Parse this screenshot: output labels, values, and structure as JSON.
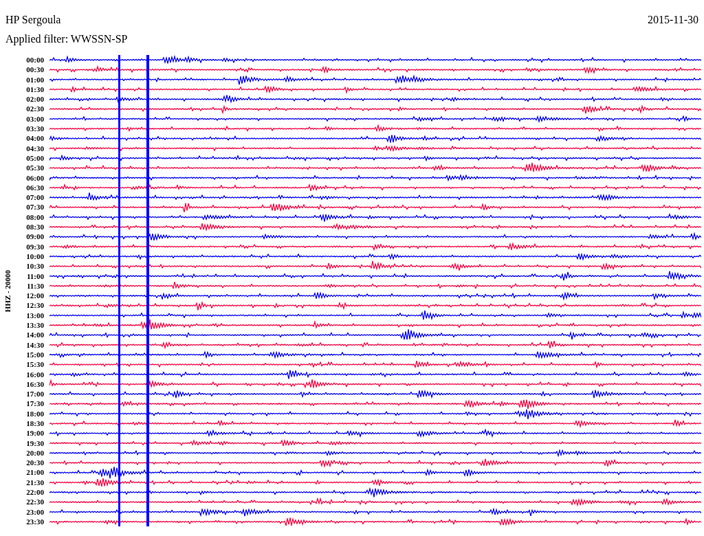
{
  "header": {
    "station": "HP Sergoula",
    "date": "2015-11-30",
    "filter": "Applied filter: WWSSN-SP"
  },
  "axis_label": "HHZ - 20000",
  "traces": [
    {
      "time": "00:00",
      "color": "#0000ff"
    },
    {
      "time": "00:30",
      "color": "#ff0040"
    },
    {
      "time": "01:00",
      "color": "#0000ff"
    },
    {
      "time": "01:30",
      "color": "#ff0040"
    },
    {
      "time": "02:00",
      "color": "#0000ff"
    },
    {
      "time": "02:30",
      "color": "#ff0040"
    },
    {
      "time": "03:00",
      "color": "#0000ff"
    },
    {
      "time": "03:30",
      "color": "#ff0040"
    },
    {
      "time": "04:00",
      "color": "#0000ff"
    },
    {
      "time": "04:30",
      "color": "#ff0040"
    },
    {
      "time": "05:00",
      "color": "#0000ff"
    },
    {
      "time": "05:30",
      "color": "#ff0040"
    },
    {
      "time": "06:00",
      "color": "#0000ff"
    },
    {
      "time": "06:30",
      "color": "#ff0040"
    },
    {
      "time": "07:00",
      "color": "#0000ff"
    },
    {
      "time": "07:30",
      "color": "#ff0040"
    },
    {
      "time": "08:00",
      "color": "#0000ff"
    },
    {
      "time": "08:30",
      "color": "#ff0040"
    },
    {
      "time": "09:00",
      "color": "#0000ff"
    },
    {
      "time": "09:30",
      "color": "#ff0040"
    },
    {
      "time": "10:00",
      "color": "#0000ff"
    },
    {
      "time": "10:30",
      "color": "#ff0040"
    },
    {
      "time": "11:00",
      "color": "#0000ff"
    },
    {
      "time": "11:30",
      "color": "#ff0040"
    },
    {
      "time": "12:00",
      "color": "#0000ff"
    },
    {
      "time": "12:30",
      "color": "#ff0040"
    },
    {
      "time": "13:00",
      "color": "#0000ff"
    },
    {
      "time": "13:30",
      "color": "#ff0040"
    },
    {
      "time": "14:00",
      "color": "#0000ff"
    },
    {
      "time": "14:30",
      "color": "#ff0040"
    },
    {
      "time": "15:00",
      "color": "#0000ff"
    },
    {
      "time": "15:30",
      "color": "#ff0040"
    },
    {
      "time": "16:00",
      "color": "#0000ff"
    },
    {
      "time": "16:30",
      "color": "#ff0040"
    },
    {
      "time": "17:00",
      "color": "#0000ff"
    },
    {
      "time": "17:30",
      "color": "#ff0040"
    },
    {
      "time": "18:00",
      "color": "#0000ff"
    },
    {
      "time": "18:30",
      "color": "#ff0040"
    },
    {
      "time": "19:00",
      "color": "#0000ff"
    },
    {
      "time": "19:30",
      "color": "#ff0040"
    },
    {
      "time": "20:00",
      "color": "#0000ff"
    },
    {
      "time": "20:30",
      "color": "#ff0040"
    },
    {
      "time": "21:00",
      "color": "#0000ff"
    },
    {
      "time": "21:30",
      "color": "#ff0040"
    },
    {
      "time": "22:00",
      "color": "#0000ff"
    },
    {
      "time": "22:30",
      "color": "#ff0040"
    },
    {
      "time": "23:00",
      "color": "#0000ff"
    },
    {
      "time": "23:30",
      "color": "#ff0040"
    }
  ]
}
